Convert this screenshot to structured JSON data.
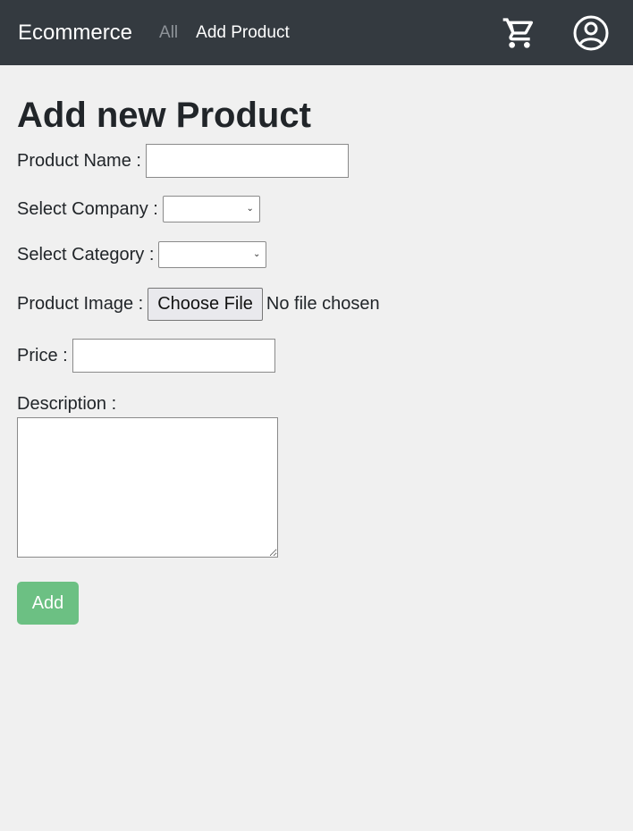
{
  "nav": {
    "brand": "Ecommerce",
    "links": [
      {
        "label": "All",
        "state": "muted"
      },
      {
        "label": "Add Product",
        "state": "active"
      }
    ],
    "icons": [
      "cart-icon",
      "account-circle-icon"
    ],
    "background": "#343a40"
  },
  "page": {
    "title": "Add new Product"
  },
  "form": {
    "product_name_label": "Product Name :",
    "product_name_value": "",
    "company_label": "Select Company :",
    "company_value": "",
    "category_label": "Select Category :",
    "category_value": "",
    "image_label": "Product Image :",
    "file_button": "Choose File",
    "file_status": "No file chosen",
    "price_label": "Price :",
    "price_value": "",
    "description_label": "Description :",
    "description_value": "",
    "submit_label": "Add",
    "submit_color": "#6cc083"
  }
}
